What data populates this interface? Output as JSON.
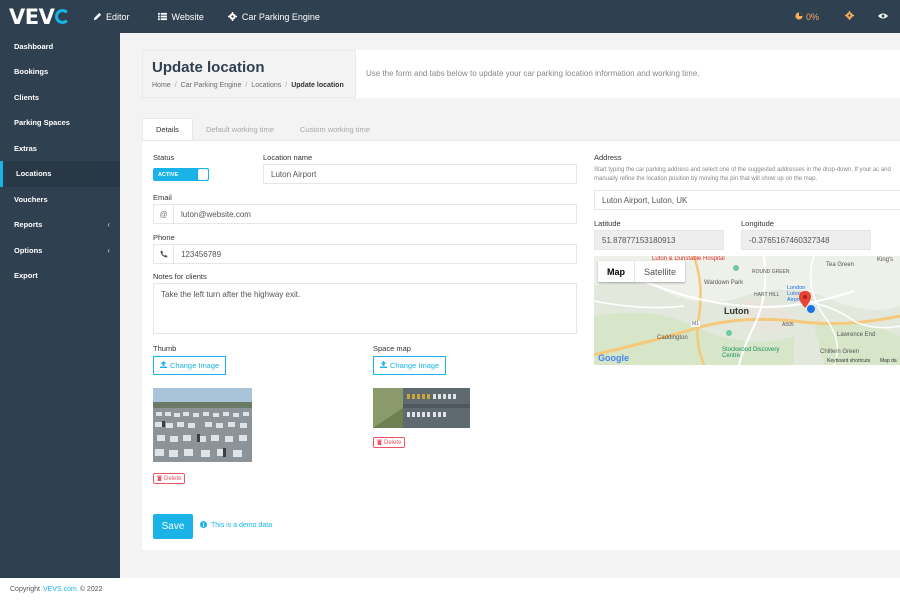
{
  "app": {
    "logo": "VEV",
    "brand_color": "#1ab3e8",
    "sidebar_color": "#2f4050"
  },
  "topnav": [
    {
      "label": "Editor",
      "icon": "pencil-icon"
    },
    {
      "label": "Website",
      "icon": "list-icon"
    },
    {
      "label": "Car Parking Engine",
      "icon": "gear-icon"
    }
  ],
  "topright": {
    "progress": "0%",
    "progress_icon": "pie-icon",
    "settings_icon": "gear-icon",
    "preview_icon": "eye-icon"
  },
  "sidebar": {
    "items": [
      {
        "label": "Dashboard"
      },
      {
        "label": "Bookings"
      },
      {
        "label": "Clients"
      },
      {
        "label": "Parking Spaces"
      },
      {
        "label": "Extras"
      },
      {
        "label": "Locations",
        "active": true
      },
      {
        "label": "Vouchers"
      },
      {
        "label": "Reports",
        "has_submenu": true
      },
      {
        "label": "Options",
        "has_submenu": true
      },
      {
        "label": "Export"
      }
    ],
    "submenu_arrow": "‹"
  },
  "header": {
    "title": "Update location",
    "breadcrumb": [
      "Home",
      "Car Parking Engine",
      "Locations",
      "Update location"
    ],
    "breadcrumb_sep": "/",
    "description": "Use the form and tabs below to update your car parking location information and working time."
  },
  "tabs": [
    "Details",
    "Default working time",
    "Custom working time"
  ],
  "form": {
    "status_label": "Status",
    "status_value": "ACTIVE",
    "location_name_label": "Location name",
    "location_name_value": "Luton Airport",
    "email_label": "Email",
    "email_value": "luton@website.com",
    "email_icon": "@",
    "phone_label": "Phone",
    "phone_value": "123456789",
    "notes_label": "Notes for clients",
    "notes_value": "Take the left turn after the highway exit.",
    "thumb_label": "Thumb",
    "space_map_label": "Space map",
    "change_image": "Change Image",
    "delete": "Delete",
    "save": "Save",
    "demo_note": "This is a demo data",
    "address_label": "Address",
    "address_help": "Start typing the car parking address and select one of the suggested addresses in the drop-down. If your ac and manually refine the location position by moving the pin that will show up on the map.",
    "address_value": "Luton Airport, Luton, UK",
    "latitude_label": "Latitude",
    "latitude_value": "51.87877153180913",
    "longitude_label": "Longitude",
    "longitude_value": "-0.3765167460327348"
  },
  "map": {
    "tab_map": "Map",
    "tab_satellite": "Satellite",
    "labels": {
      "hospital": "Luton & Dunstable Hospital",
      "wardown": "Wardown Park",
      "round_green": "ROUND GREEN",
      "hart_hill": "HART HILL",
      "airport": "London Luton Airport",
      "luton": "Luton",
      "tea_green": "Tea Green",
      "kings": "King's",
      "caddington": "Caddington",
      "stockwood": "Stockwood Discovery Centre",
      "lawrence": "Lawrence End",
      "chiltern": "Chiltern Green",
      "m1": "M1",
      "a505": "A505",
      "google": "Google",
      "shortcuts": "Keyboard shortcuts",
      "mapdata": "Map da"
    }
  },
  "footer": {
    "prefix": "Copyright",
    "brand": "VEVS.com",
    "suffix": "© 2022"
  }
}
